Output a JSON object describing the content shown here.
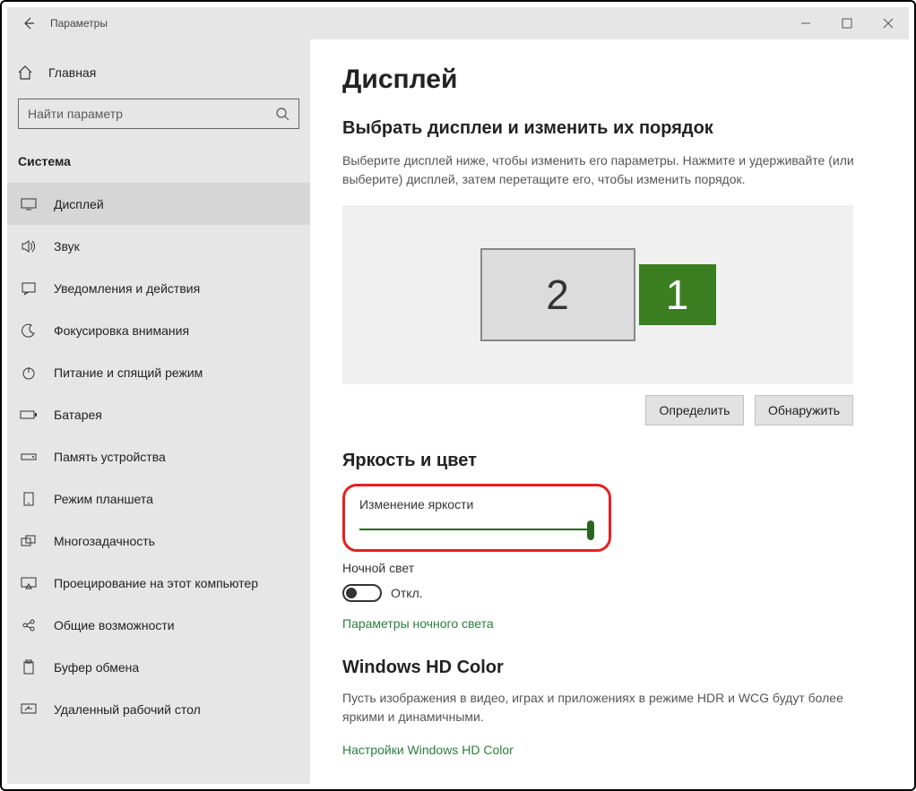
{
  "titlebar": {
    "app_title": "Параметры"
  },
  "sidebar": {
    "home_label": "Главная",
    "search_placeholder": "Найти параметр",
    "category_label": "Система",
    "items": [
      {
        "label": "Дисплей"
      },
      {
        "label": "Звук"
      },
      {
        "label": "Уведомления и действия"
      },
      {
        "label": "Фокусировка внимания"
      },
      {
        "label": "Питание и спящий режим"
      },
      {
        "label": "Батарея"
      },
      {
        "label": "Память устройства"
      },
      {
        "label": "Режим планшета"
      },
      {
        "label": "Многозадачность"
      },
      {
        "label": "Проецирование на этот компьютер"
      },
      {
        "label": "Общие возможности"
      },
      {
        "label": "Буфер обмена"
      },
      {
        "label": "Удаленный рабочий стол"
      }
    ]
  },
  "content": {
    "page_title": "Дисплей",
    "arrange_heading": "Выбрать дисплеи и изменить их порядок",
    "arrange_help": "Выберите дисплей ниже, чтобы изменить его параметры. Нажмите и удерживайте (или выберите) дисплей, затем перетащите его, чтобы изменить порядок.",
    "monitor2": "2",
    "monitor1": "1",
    "identify_btn": "Определить",
    "detect_btn": "Обнаружить",
    "brightness_heading": "Яркость и цвет",
    "brightness_label": "Изменение яркости",
    "night_light_label": "Ночной свет",
    "toggle_off": "Откл.",
    "night_light_link": "Параметры ночного света",
    "hd_heading": "Windows HD Color",
    "hd_help": "Пусть изображения в видео, играх и приложениях в режиме HDR и WCG будут более яркими и динамичными.",
    "hd_link": "Настройки Windows HD Color"
  }
}
